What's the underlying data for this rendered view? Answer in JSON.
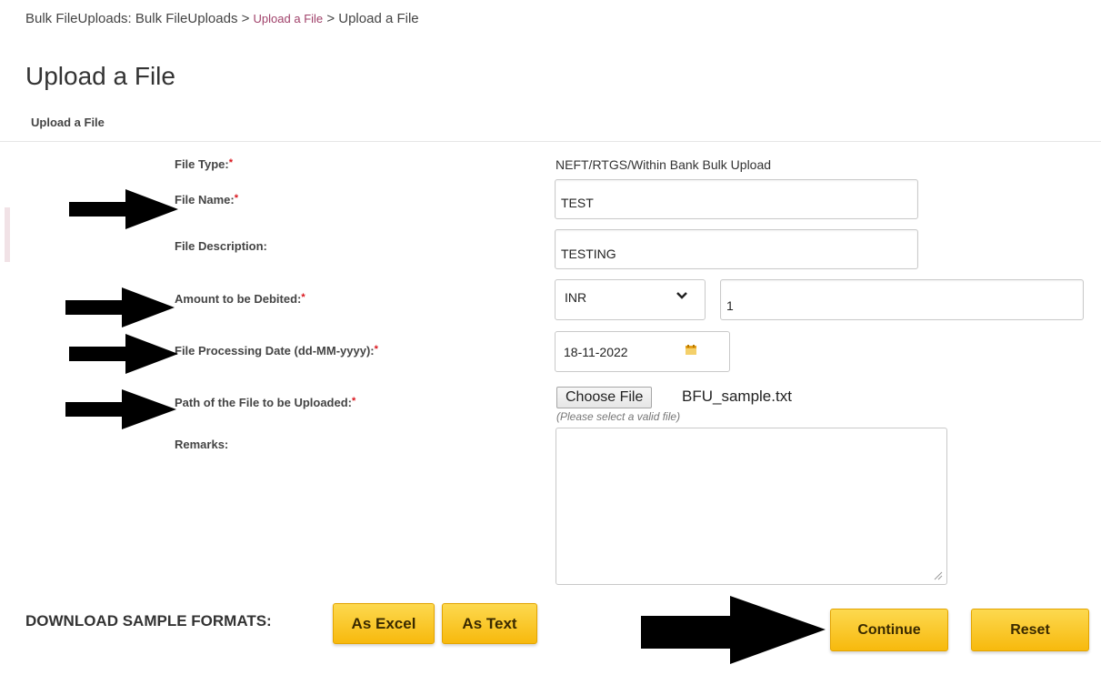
{
  "breadcrumb": {
    "prefix": "Bulk FileUploads: Bulk FileUploads > ",
    "link": "Upload a File",
    "suffix": " > Upload a File"
  },
  "page_title": "Upload a File",
  "section_title": "Upload a File",
  "form": {
    "file_type": {
      "label": "File Type:",
      "value": "NEFT/RTGS/Within Bank Bulk Upload"
    },
    "file_name": {
      "label": "File Name:",
      "value": "TEST"
    },
    "file_description": {
      "label": "File Description:",
      "value": "TESTING"
    },
    "amount": {
      "label": "Amount to be Debited:",
      "currency": "INR",
      "value": "1"
    },
    "processing_date": {
      "label": "File Processing Date (dd-MM-yyyy):",
      "value": "18-11-2022"
    },
    "file_path": {
      "label": "Path of the File to be Uploaded:",
      "button": "Choose File",
      "file_name": "BFU_sample.txt",
      "hint": "(Please select a valid file)"
    },
    "remarks": {
      "label": "Remarks:",
      "value": ""
    },
    "required_marker": "*"
  },
  "download": {
    "label": "DOWNLOAD SAMPLE FORMATS:",
    "excel": "As Excel",
    "text": "As Text"
  },
  "actions": {
    "continue": "Continue",
    "reset": "Reset"
  },
  "colors": {
    "accent_yellow": "#f7b90d",
    "link": "#a0416a",
    "required": "#d9141c"
  }
}
